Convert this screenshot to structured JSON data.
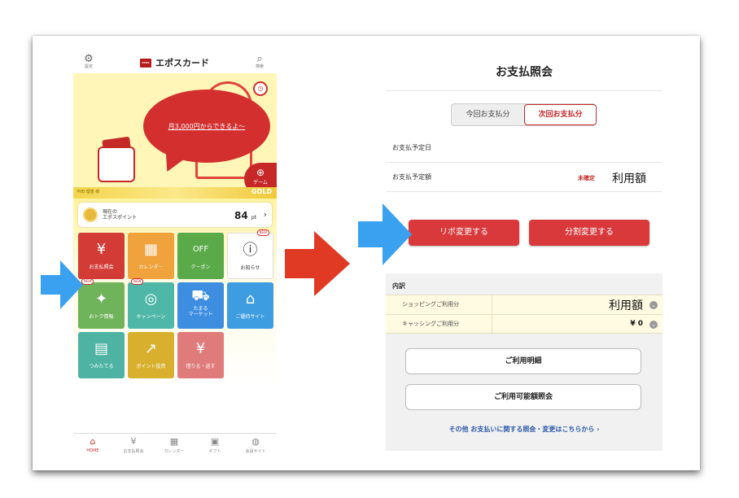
{
  "left_app": {
    "header": {
      "settings_label": "設定",
      "brand_logo": "EPOS",
      "brand_name": "エポスカード",
      "search_label": "検索"
    },
    "hero": {
      "bubble_text": "月3,000円からできるよ～",
      "game_label": "ゲーム"
    },
    "gold_band": {
      "left_text": "平田 理恵 様",
      "right_text": "GOLD"
    },
    "points": {
      "label": "現在の\nエポスポイント",
      "value": "84",
      "unit": "pt"
    },
    "tiles": [
      {
        "label": "お支払照会",
        "icon": "¥",
        "color": "#d33b37",
        "new": ""
      },
      {
        "label": "カレンダー",
        "icon": "▦",
        "color": "#f0a23c",
        "new": ""
      },
      {
        "label": "クーポン",
        "icon": "OFF",
        "color": "#5aaa4a",
        "new": ""
      },
      {
        "label": "お知らせ",
        "icon": "!",
        "color": "#ffffff",
        "new": "NEW"
      },
      {
        "label": "おトク情報",
        "icon": "✦",
        "color": "#6fb35a",
        "new": "NEW"
      },
      {
        "label": "キャンペーン",
        "icon": "◎",
        "color": "#4fb7a8",
        "new": "NEW"
      },
      {
        "label": "たまる\nマーケット",
        "icon": "⛟",
        "color": "#3d8ee0",
        "new": ""
      },
      {
        "label": "ご優待サイト",
        "icon": "⌂",
        "color": "#3d9de0",
        "new": ""
      },
      {
        "label": "つみたてる",
        "icon": "▤",
        "color": "#4fb3a4",
        "new": ""
      },
      {
        "label": "ポイント投資",
        "icon": "↗",
        "color": "#d8b02e",
        "new": ""
      },
      {
        "label": "借りる・返す",
        "icon": "¥",
        "color": "#e07b7b",
        "new": ""
      }
    ],
    "bottom_nav": [
      {
        "label": "HOME",
        "icon": "⌂"
      },
      {
        "label": "お支払照会",
        "icon": "¥"
      },
      {
        "label": "カレンダー",
        "icon": "▦"
      },
      {
        "label": "ギフト",
        "icon": "🎁"
      },
      {
        "label": "会員サイト",
        "icon": "☖"
      }
    ]
  },
  "right_app": {
    "title": "お支払照会",
    "tabs": {
      "current": "今回お支払分",
      "next": "次回お支払分"
    },
    "rows": {
      "due_date_label": "お支払予定日",
      "due_amount_label": "お支払予定額",
      "status_tag": "未確定",
      "amount_value": "利用額"
    },
    "buttons": {
      "revo": "リボ変更する",
      "split": "分割変更する"
    },
    "breakdown": {
      "title": "内訳",
      "shopping_label": "ショッピングご利用分",
      "shopping_value": "利用額",
      "cashing_label": "キャッシングご利用分",
      "cashing_value": "¥ 0"
    },
    "details_button": "ご利用明細",
    "available_button": "ご利用可能額照会",
    "other_link": "その他 お支払いに関する照会・変更はこちらから ›"
  },
  "colors": {
    "brand_red": "#d32f2f",
    "arrow_blue": "#3aa0f0",
    "arrow_red": "#e03a24",
    "gold": "#f3d54a"
  }
}
